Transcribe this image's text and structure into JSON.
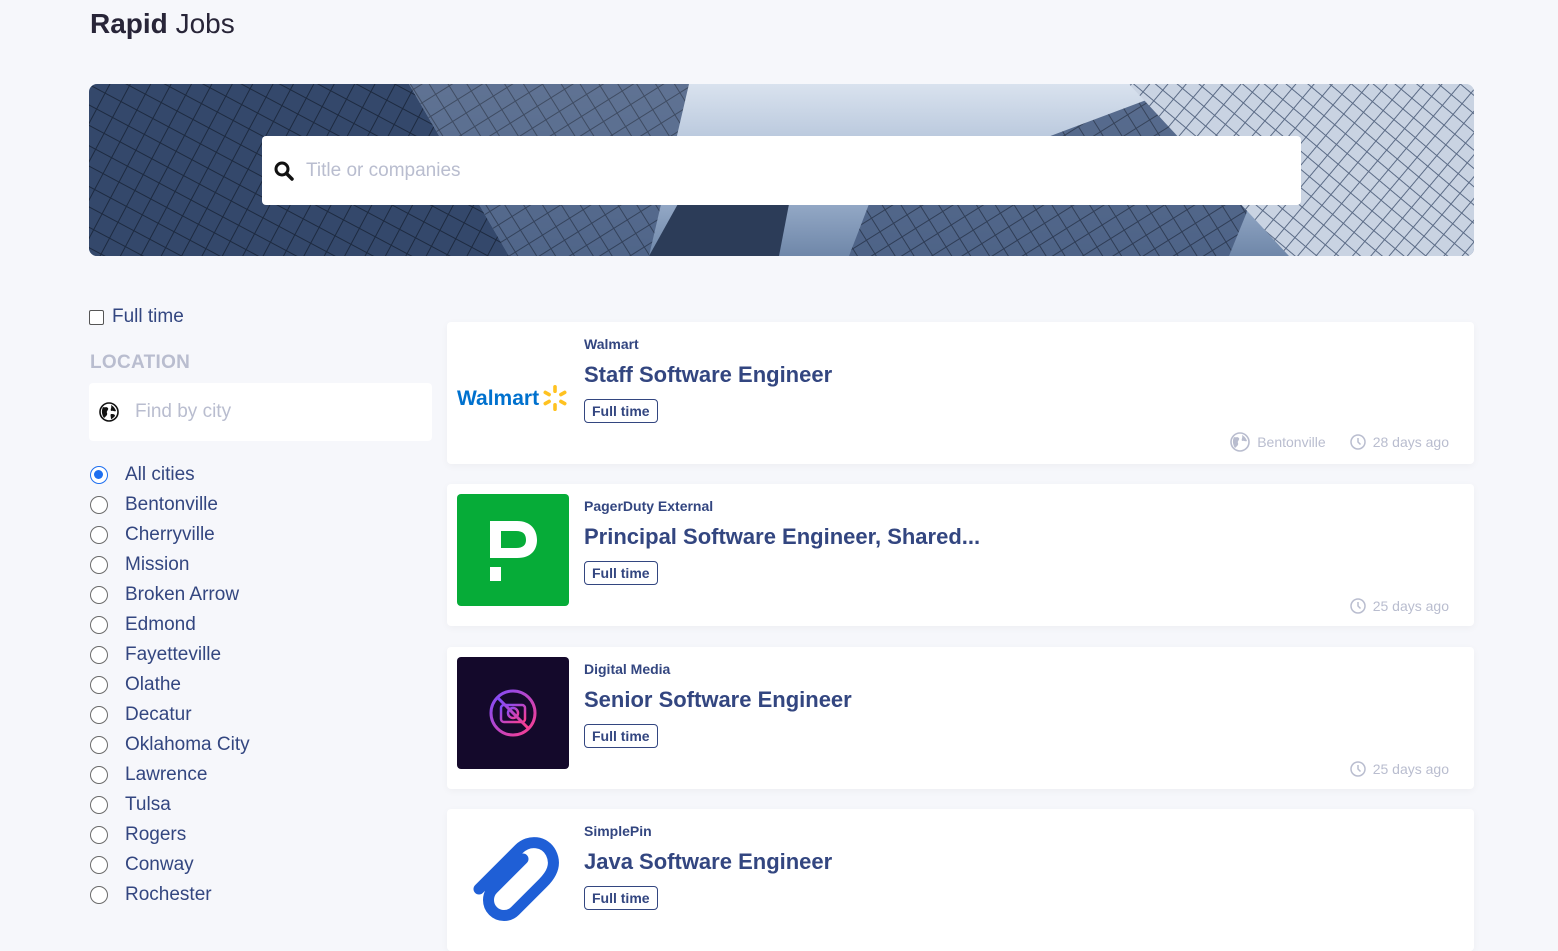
{
  "brand": {
    "bold": "Rapid",
    "light": "Jobs"
  },
  "search": {
    "placeholder": "Title or companies"
  },
  "filters": {
    "full_time_label": "Full time",
    "location_heading": "LOCATION",
    "city_placeholder": "Find by city",
    "cities": [
      "All cities",
      "Bentonville",
      "Cherryville",
      "Mission",
      "Broken Arrow",
      "Edmond",
      "Fayetteville",
      "Olathe",
      "Decatur",
      "Oklahoma City",
      "Lawrence",
      "Tulsa",
      "Rogers",
      "Conway",
      "Rochester"
    ],
    "selected_city": "All cities"
  },
  "jobs": [
    {
      "company": "Walmart",
      "title": "Staff Software Engineer",
      "type": "Full time",
      "location": "Bentonville",
      "posted": "28 days ago",
      "logo_text": "Walmart"
    },
    {
      "company": "PagerDuty External",
      "title": "Principal Software Engineer, Shared...",
      "type": "Full time",
      "location": "",
      "posted": "25 days ago",
      "logo_text": "P"
    },
    {
      "company": "Digital Media",
      "title": "Senior Software Engineer",
      "type": "Full time",
      "location": "",
      "posted": "25 days ago",
      "logo_text": ""
    },
    {
      "company": "SimplePin",
      "title": "Java Software Engineer",
      "type": "Full time",
      "location": "",
      "posted": "",
      "logo_text": ""
    }
  ],
  "colors": {
    "accent": "#334680",
    "muted": "#b9bdcf",
    "radio": "#1e6ff0",
    "background": "#f6f7fb"
  },
  "icons": {
    "search": "search-icon",
    "globe": "globe-icon",
    "clock": "clock-icon"
  }
}
